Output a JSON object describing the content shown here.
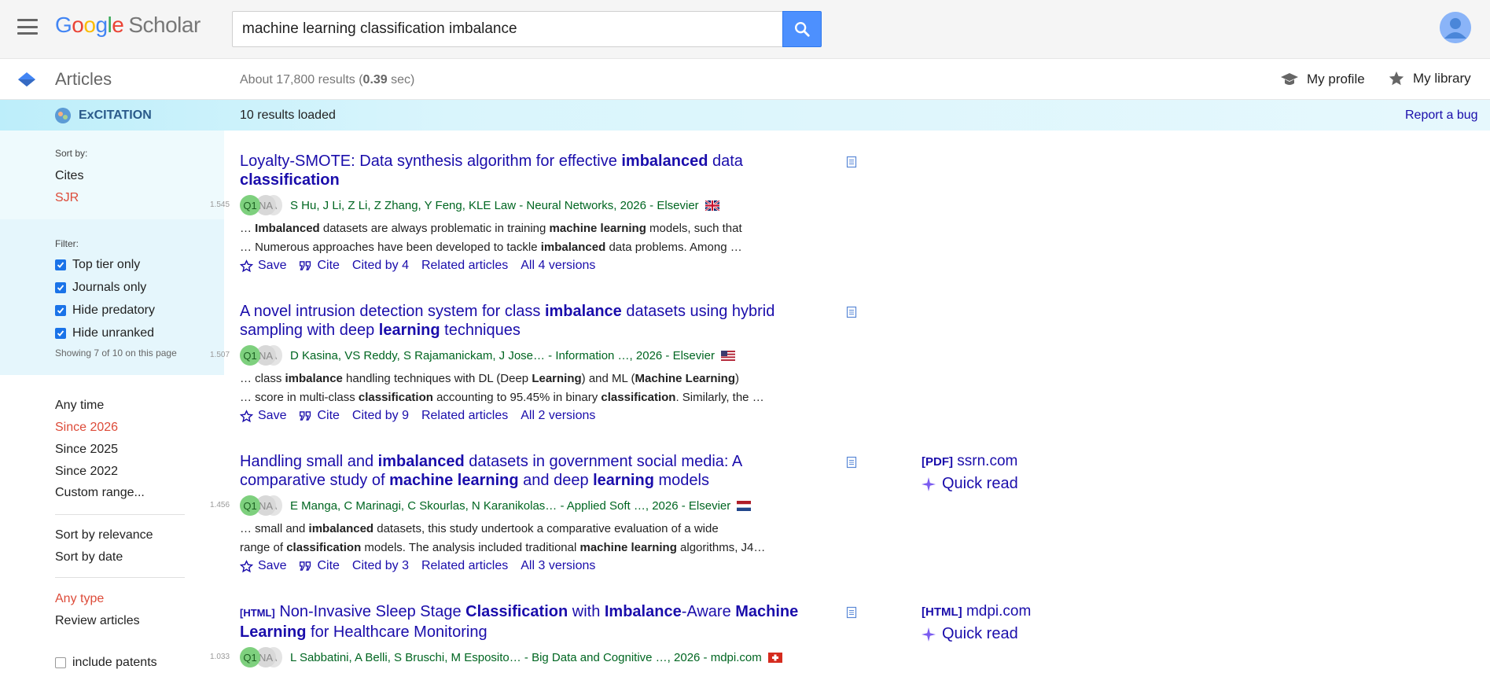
{
  "header": {
    "logo_g": [
      "G",
      "o",
      "o",
      "g",
      "l",
      "e"
    ],
    "logo_scholar": "Scholar",
    "search_query": "machine learning classification imbalance"
  },
  "subheader": {
    "section": "Articles",
    "results_prefix": "About 17,800 results (",
    "results_time": "0.39",
    "results_suffix": " sec)",
    "my_profile": "My profile",
    "my_library": "My library"
  },
  "excitation": {
    "name": "ExCITATION",
    "loaded": "10 results loaded",
    "report_bug": "Report a bug"
  },
  "left": {
    "sort_by_label": "Sort by:",
    "sort_cites": "Cites",
    "sort_sjr": "SJR",
    "filter_label": "Filter:",
    "filters": [
      "Top tier only",
      "Journals only",
      "Hide predatory",
      "Hide unranked"
    ],
    "showing": "Showing 7 of 10 on this page",
    "time": [
      "Any time",
      "Since 2026",
      "Since 2025",
      "Since 2022",
      "Custom range..."
    ],
    "sort": [
      "Sort by relevance",
      "Sort by date"
    ],
    "type": [
      "Any type",
      "Review articles"
    ],
    "include_patents": "include patents"
  },
  "results": [
    {
      "title_parts": [
        "Loyalty-SMOTE: Data synthesis algorithm for effective ",
        "imbalanced",
        " data ",
        "classification"
      ],
      "score": "1.545",
      "badges": [
        "Q1",
        "NA",
        "A"
      ],
      "authors": "S Hu, J Li, Z Li, Z Zhang, Y Feng, KLE Law - Neural Networks, 2026 - Elsevier",
      "snippet1": [
        "… ",
        "Imbalanced",
        " datasets are always problematic in training ",
        "machine learning",
        " models, such that"
      ],
      "snippet2": [
        "… Numerous approaches have been developed to tackle ",
        "imbalanced",
        " data problems. Among …"
      ],
      "actions": [
        "Save",
        "Cite",
        "Cited by 4",
        "Related articles",
        "All 4 versions"
      ]
    },
    {
      "title_parts": [
        "A novel intrusion detection system for class ",
        "imbalance",
        " datasets using hybrid sampling with deep ",
        "learning",
        " techniques"
      ],
      "score": "1.507",
      "badges": [
        "Q1",
        "NA",
        "A"
      ],
      "authors": "D Kasina, VS Reddy, S Rajamanickam, J Jose… - Information …, 2026 - Elsevier",
      "snippet1": [
        "… class ",
        "imbalance",
        " handling techniques with DL (Deep ",
        "Learning",
        ") and ML (",
        "Machine Learning",
        ")"
      ],
      "snippet2": [
        "… score in multi-class ",
        "classification",
        " accounting to 95.45% in binary ",
        "classification",
        ". Similarly, the …"
      ],
      "actions": [
        "Save",
        "Cite",
        "Cited by 9",
        "Related articles",
        "All 2 versions"
      ]
    },
    {
      "title_parts": [
        "Handling small and ",
        "imbalanced",
        " datasets in government social media: A comparative study of ",
        "machine learning",
        " and deep ",
        "learning",
        " models"
      ],
      "score": "1.456",
      "badges": [
        "Q1",
        "NA",
        "A"
      ],
      "authors": "E Manga, C Marinagi, C Skourlas, N Karanikolas… - Applied Soft …, 2026 - Elsevier",
      "snippet1": [
        "… small and ",
        "imbalanced",
        " datasets, this study undertook a comparative evaluation of a wide"
      ],
      "snippet2": [
        "range of ",
        "classification",
        " models. The analysis included traditional ",
        "machine learning",
        " algorithms, J4…"
      ],
      "actions": [
        "Save",
        "Cite",
        "Cited by 3",
        "Related articles",
        "All 3 versions"
      ],
      "side_tag": "[PDF]",
      "side_src": "ssrn.com",
      "quick_read": "Quick read"
    },
    {
      "title_tag": "[HTML]",
      "title_parts": [
        " Non-Invasive Sleep Stage ",
        "Classification",
        " with ",
        "Imbalance",
        "-Aware ",
        "Machine Learning",
        " for Healthcare Monitoring"
      ],
      "score": "1.033",
      "badges": [
        "Q1",
        "NA",
        "A"
      ],
      "authors": "L Sabbatini, A Belli, S Bruschi, M Esposito… - Big Data and Cognitive …, 2026 - mdpi.com",
      "side_tag": "[HTML]",
      "side_src": "mdpi.com",
      "quick_read": "Quick read"
    }
  ],
  "colors": {
    "link": "#1a0dab",
    "author_green": "#006621",
    "accent_red": "#dd4b39",
    "search_blue": "#4d90fe"
  }
}
